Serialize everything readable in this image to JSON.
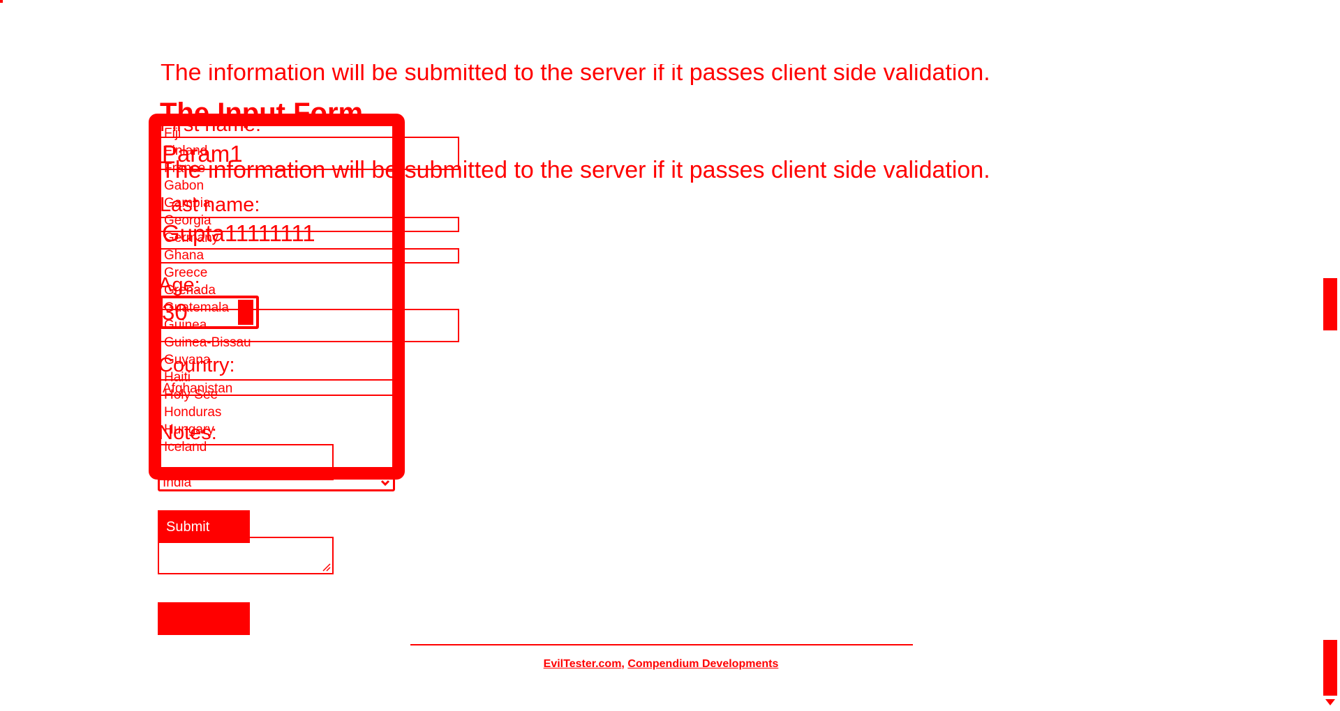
{
  "page": {
    "title": "The Input Form",
    "description": "The information will be submitted to the server if it passes client side validation."
  },
  "form": {
    "first_name_label": "First name:",
    "first_name_value": "Param1",
    "last_name_label": "Last name:",
    "last_name_value": "Gupta11111111",
    "age_label": "Age:",
    "age_value": "30",
    "country_label": "Country:",
    "country_value": "India",
    "notes_label": "Notes:",
    "submit_label": "Submit"
  },
  "country_options": [
    "Fiji",
    "Finland",
    "France",
    "Gabon",
    "Gambia",
    "Georgia",
    "Germany",
    "Ghana",
    "Greece",
    "Grenada",
    "Guatemala",
    "Guinea",
    "Guinea-Bissau",
    "Guyana",
    "Haiti",
    "Holy See",
    "Honduras",
    "Hungary",
    "Iceland",
    "India"
  ],
  "country_first_option": "Afghanistan",
  "footer": {
    "link1": "EvilTester.com",
    "separator": ", ",
    "link2": "Compendium Developments"
  },
  "colors": {
    "primary": "#ff0000",
    "background": "#ffffff"
  },
  "icons": {
    "select_arrow": "chevron-down-icon",
    "scroll_down": "arrow-down-icon",
    "resize": "resize-grip-icon"
  }
}
